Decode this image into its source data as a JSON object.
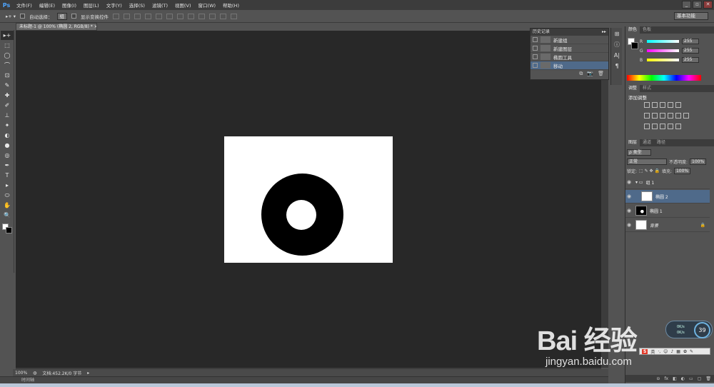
{
  "app": {
    "logo": "Ps"
  },
  "menu": [
    "文件(F)",
    "编辑(E)",
    "图像(I)",
    "图层(L)",
    "文字(Y)",
    "选择(S)",
    "滤镜(T)",
    "视图(V)",
    "窗口(W)",
    "帮助(H)"
  ],
  "window_controls": {
    "minimize": "_",
    "restore": "▫",
    "close": "✕"
  },
  "options": {
    "auto_select_label": "自动选择：",
    "auto_select_value": "组",
    "show_transform_label": "显示变换控件",
    "workspace": "基本功能"
  },
  "toolbox": [
    "▸+",
    "⬚",
    "◯",
    "⌒",
    "⊡",
    "✎",
    "✚",
    "✐",
    "⊥",
    "✦",
    "◐",
    "●",
    "◎",
    "✒",
    "T",
    "▸",
    "⬭",
    "✋",
    "🔍"
  ],
  "document": {
    "tab_title": "未标题-1 @ 100% (椭圆 2, RGB/8) *",
    "tab_close": "×",
    "zoom": "100%",
    "doc_info": "文档:452.2K/0 字节",
    "timeline_label": "时间轴"
  },
  "history": {
    "tab_label": "历史记录",
    "collapse": "▸▸",
    "items": [
      {
        "label": "新建组",
        "active": false
      },
      {
        "label": "新建图层",
        "active": false
      },
      {
        "label": "椭圆工具",
        "active": false
      },
      {
        "label": "移动",
        "active": true
      }
    ],
    "footer_icons": [
      "⧉",
      "📷",
      "🗑"
    ]
  },
  "mini_dock": [
    "⊞",
    "ⓘ",
    "A|",
    "¶"
  ],
  "color_panel": {
    "tabs": [
      "颜色",
      "色板"
    ],
    "channels": [
      {
        "label": "R",
        "value": "255",
        "gradient": "#00ffff"
      },
      {
        "label": "G",
        "value": "255",
        "gradient": "#ff00ff"
      },
      {
        "label": "B",
        "value": "255",
        "gradient": "#ffff00"
      }
    ]
  },
  "adjustments": {
    "tabs": [
      "调整",
      "样式"
    ],
    "title": "添加调整"
  },
  "layers": {
    "tabs": [
      "图层",
      "通道",
      "路径"
    ],
    "filter_kind": "ρ 类型",
    "blend_mode": "正常",
    "opacity_label": "不透明度:",
    "opacity_value": "100%",
    "lock_label": "锁定:",
    "fill_label": "填充:",
    "fill_value": "100%",
    "items": [
      {
        "name": "组 1",
        "type": "group",
        "selected": false
      },
      {
        "name": "椭圆 2",
        "type": "shape-white",
        "selected": true
      },
      {
        "name": "椭圆 1",
        "type": "shape-dark",
        "selected": false
      },
      {
        "name": "背景",
        "type": "background",
        "selected": false
      }
    ],
    "footer_icons": [
      "⊝",
      "fx",
      "◧",
      "◐",
      "▭",
      "▢",
      "🗑"
    ]
  },
  "overlays": {
    "perf_line1": "0K/s",
    "perf_line2": "0K/s",
    "perf_percent": "39",
    "ime_logo": "S",
    "ime_label": "英"
  },
  "watermark": {
    "brand": "Bai 经验",
    "url": "jingyan.baidu.com"
  }
}
